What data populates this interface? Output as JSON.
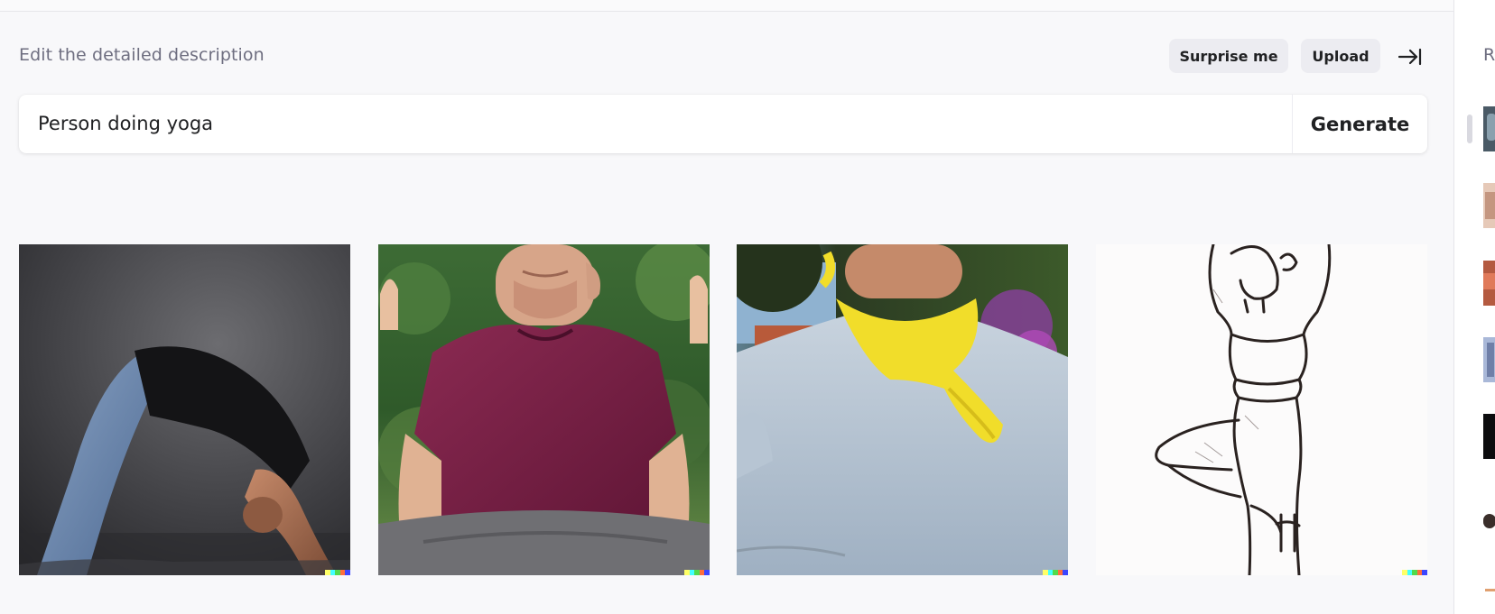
{
  "header": {
    "edit_label": "Edit the detailed description",
    "surprise_label": "Surprise me",
    "upload_label": "Upload",
    "collapse_icon": "arrow-right-to-bar-icon"
  },
  "prompt": {
    "value": "Person doing yoga",
    "placeholder": "",
    "generate_label": "Generate"
  },
  "results": [
    {
      "name": "result-image-1",
      "subject": "person in wheel pose"
    },
    {
      "name": "result-image-2",
      "subject": "man in maroon shirt meditating"
    },
    {
      "name": "result-image-3",
      "subject": "man with yellow scarf"
    },
    {
      "name": "result-image-4",
      "subject": "sketch of woman in tree pose"
    }
  ],
  "watermark_colors": [
    "#ffff66",
    "#42ffff",
    "#51da4c",
    "#ff6e3c",
    "#3c46ff"
  ],
  "sidebar": {
    "heading": "R",
    "history_count": 7
  }
}
